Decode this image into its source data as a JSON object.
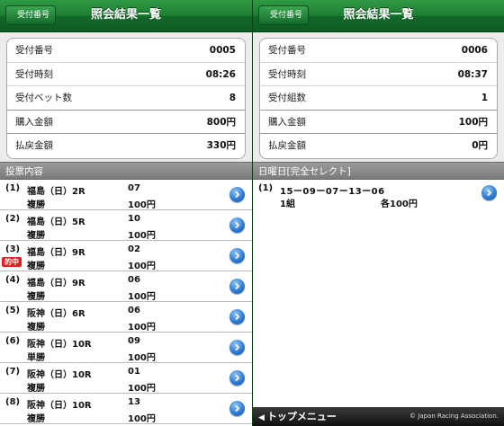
{
  "left": {
    "back_label": "受付番号",
    "title": "照会結果一覧",
    "summary": [
      {
        "label": "受付番号",
        "value": "0005"
      },
      {
        "label": "受付時刻",
        "value": "08:26"
      },
      {
        "label": "受付ベット数",
        "value": "8"
      },
      {
        "label": "購入金額",
        "value": "800円"
      },
      {
        "label": "払戻金額",
        "value": "330円"
      }
    ],
    "section_title": "投票内容",
    "bets": [
      {
        "index": "(1)",
        "race": "福島（日）2R",
        "type": "複勝",
        "numbers": "07",
        "amount": "100円",
        "hit": ""
      },
      {
        "index": "(2)",
        "race": "福島（日）5R",
        "type": "複勝",
        "numbers": "10",
        "amount": "100円",
        "hit": ""
      },
      {
        "index": "(3)",
        "race": "福島（日）9R",
        "type": "複勝",
        "numbers": "02",
        "amount": "100円",
        "hit": "的中"
      },
      {
        "index": "(4)",
        "race": "福島（日）9R",
        "type": "複勝",
        "numbers": "06",
        "amount": "100円",
        "hit": ""
      },
      {
        "index": "(5)",
        "race": "阪神（日）6R",
        "type": "複勝",
        "numbers": "06",
        "amount": "100円",
        "hit": ""
      },
      {
        "index": "(6)",
        "race": "阪神（日）10R",
        "type": "単勝",
        "numbers": "09",
        "amount": "100円",
        "hit": ""
      },
      {
        "index": "(7)",
        "race": "阪神（日）10R",
        "type": "複勝",
        "numbers": "01",
        "amount": "100円",
        "hit": ""
      },
      {
        "index": "(8)",
        "race": "阪神（日）10R",
        "type": "複勝",
        "numbers": "13",
        "amount": "100円",
        "hit": ""
      }
    ]
  },
  "right": {
    "back_label": "受付番号",
    "title": "照会結果一覧",
    "summary": [
      {
        "label": "受付番号",
        "value": "0006"
      },
      {
        "label": "受付時刻",
        "value": "08:37"
      },
      {
        "label": "受付組数",
        "value": "1"
      },
      {
        "label": "購入金額",
        "value": "100円"
      },
      {
        "label": "払戻金額",
        "value": "0円"
      }
    ],
    "section_title": "日曜日[完全セレクト]",
    "picks": [
      {
        "index": "(1)",
        "combo": "15ー09ー07ー13ー06",
        "sets": "1組",
        "amount": "各100円"
      }
    ]
  },
  "footer": {
    "menu_label": "トップメニュー",
    "copyright": "© Japan Racing Association."
  },
  "icons": {
    "back": "back-arrow-icon",
    "detail": "chevron-right-circle-icon",
    "menu": "triangle-left-icon"
  }
}
